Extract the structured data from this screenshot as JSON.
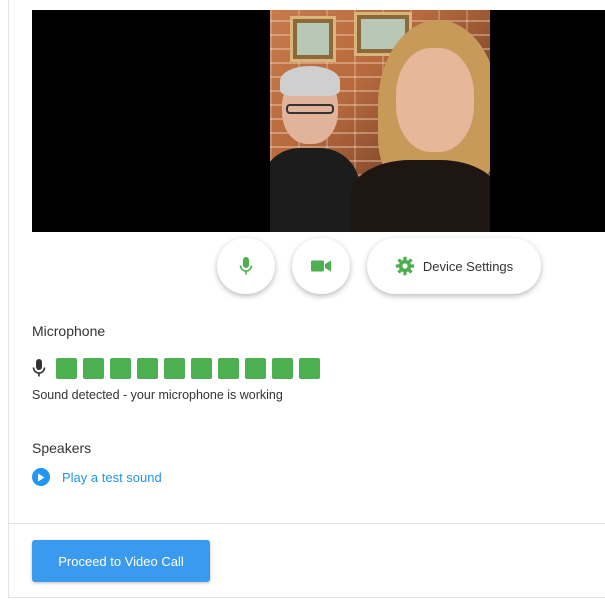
{
  "controls": {
    "device_settings_label": "Device Settings",
    "icons": {
      "mic": "microphone-icon",
      "camera": "video-camera-icon",
      "settings": "gear-icon"
    }
  },
  "microphone": {
    "title": "Microphone",
    "level_bars_active": 10,
    "level_bars_total": 10,
    "status": "Sound detected - your microphone is working"
  },
  "speakers": {
    "title": "Speakers",
    "test_label": "Play a test sound"
  },
  "footer": {
    "proceed_label": "Proceed to Video Call"
  },
  "colors": {
    "accent_green": "#4caf50",
    "accent_blue": "#2196f3",
    "button_blue": "#3a9af0"
  }
}
